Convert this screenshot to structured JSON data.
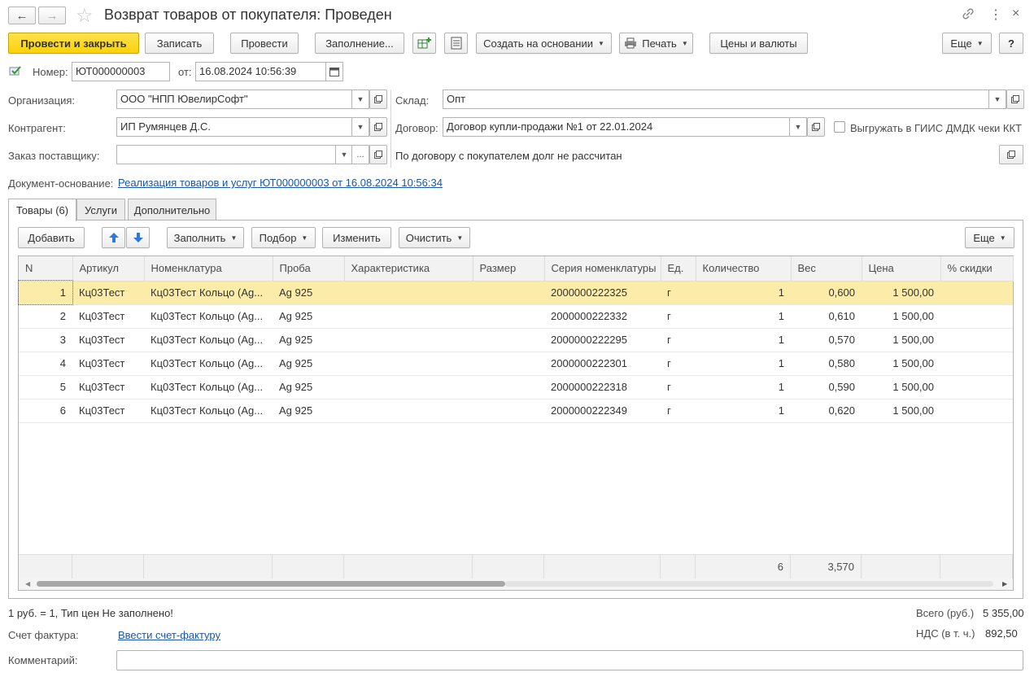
{
  "window": {
    "title": "Возврат товаров от покупателя: Проведен"
  },
  "toolbar": {
    "post_close": "Провести и закрыть",
    "save": "Записать",
    "post": "Провести",
    "fill": "Заполнение...",
    "create_based": "Создать на основании",
    "print": "Печать",
    "prices": "Цены и валюты",
    "more": "Еще",
    "help": "?"
  },
  "header": {
    "number_label": "Номер:",
    "number_value": "ЮТ000000003",
    "date_label": "от:",
    "date_value": "16.08.2024 10:56:39",
    "org_label": "Организация:",
    "org_value": "ООО \"НПП ЮвелирСофт\"",
    "contractor_label": "Контрагент:",
    "contractor_value": "ИП Румянцев Д.С.",
    "order_label": "Заказ поставщику:",
    "order_value": "",
    "warehouse_label": "Склад:",
    "warehouse_value": "Опт",
    "contract_label": "Договор:",
    "contract_value": "Договор купли-продажи №1 от 22.01.2024",
    "giis_checkbox_label": "Выгружать в ГИИС ДМДК чеки ККТ",
    "debt_text": "По договору с покупателем долг не рассчитан",
    "base_doc_label": "Документ-основание:",
    "base_doc_link": "Реализация товаров и услуг ЮТ000000003 от 16.08.2024 10:56:34"
  },
  "tabs": [
    {
      "label": "Товары (6)"
    },
    {
      "label": "Услуги"
    },
    {
      "label": "Дополнительно"
    }
  ],
  "table_toolbar": {
    "add": "Добавить",
    "fill": "Заполнить",
    "select": "Подбор",
    "edit": "Изменить",
    "clear": "Очистить",
    "more": "Еще"
  },
  "table": {
    "columns": [
      "N",
      "Артикул",
      "Номенклатура",
      "Проба",
      "Характеристика",
      "Размер",
      "Серия номенклатуры",
      "Ед.",
      "Количество",
      "Вес",
      "Цена",
      "% скидки"
    ],
    "rows": [
      {
        "n": "1",
        "article": "Кц03Тест",
        "item": "Кц03Тест Кольцо (Ag...",
        "probe": "Ag 925",
        "char": "",
        "size": "",
        "series": "2000000222325",
        "unit": "г",
        "qty": "1",
        "weight": "0,600",
        "price": "1 500,00",
        "discount": ""
      },
      {
        "n": "2",
        "article": "Кц03Тест",
        "item": "Кц03Тест Кольцо (Ag...",
        "probe": "Ag 925",
        "char": "",
        "size": "",
        "series": "2000000222332",
        "unit": "г",
        "qty": "1",
        "weight": "0,610",
        "price": "1 500,00",
        "discount": ""
      },
      {
        "n": "3",
        "article": "Кц03Тест",
        "item": "Кц03Тест Кольцо (Ag...",
        "probe": "Ag 925",
        "char": "",
        "size": "",
        "series": "2000000222295",
        "unit": "г",
        "qty": "1",
        "weight": "0,570",
        "price": "1 500,00",
        "discount": ""
      },
      {
        "n": "4",
        "article": "Кц03Тест",
        "item": "Кц03Тест Кольцо (Ag...",
        "probe": "Ag 925",
        "char": "",
        "size": "",
        "series": "2000000222301",
        "unit": "г",
        "qty": "1",
        "weight": "0,580",
        "price": "1 500,00",
        "discount": ""
      },
      {
        "n": "5",
        "article": "Кц03Тест",
        "item": "Кц03Тест Кольцо (Ag...",
        "probe": "Ag 925",
        "char": "",
        "size": "",
        "series": "2000000222318",
        "unit": "г",
        "qty": "1",
        "weight": "0,590",
        "price": "1 500,00",
        "discount": ""
      },
      {
        "n": "6",
        "article": "Кц03Тест",
        "item": "Кц03Тест Кольцо (Ag...",
        "probe": "Ag 925",
        "char": "",
        "size": "",
        "series": "2000000222349",
        "unit": "г",
        "qty": "1",
        "weight": "0,620",
        "price": "1 500,00",
        "discount": ""
      }
    ],
    "totals": {
      "qty": "6",
      "weight": "3,570"
    }
  },
  "footer": {
    "currency_text": "1 руб. = 1, Тип цен Не заполнено!",
    "invoice_label": "Счет фактура:",
    "invoice_link": "Ввести счет-фактуру",
    "total_label": "Всего (руб.)",
    "total_value": "5 355,00",
    "vat_label": "НДС (в т. ч.)",
    "vat_value": "892,50",
    "comment_label": "Комментарий:",
    "comment_value": ""
  },
  "colors": {
    "primary_button": "#fbd20a",
    "selected_row": "#fbeda9",
    "link": "#1a56a5"
  }
}
